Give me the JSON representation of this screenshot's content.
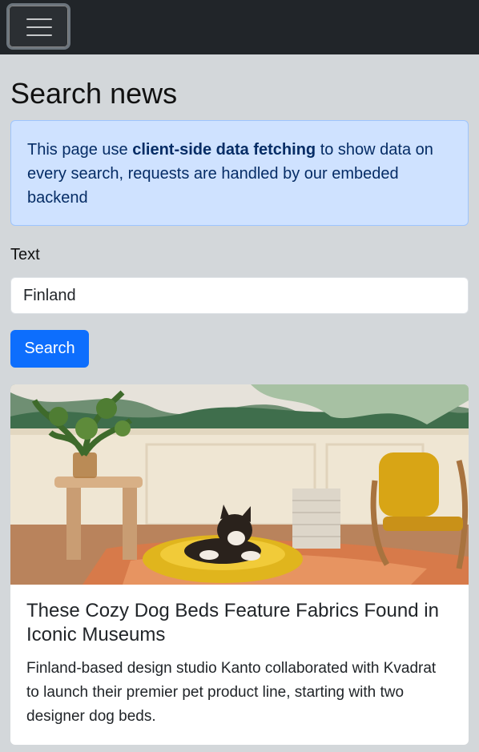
{
  "nav": {
    "menu_icon": "hamburger-menu-icon"
  },
  "page": {
    "title": "Search news",
    "alert": {
      "prefix": "This page use ",
      "bold": "client-side data fetching",
      "suffix": " to show data on every search, requests are handled by our embeded backend"
    },
    "field_label": "Text",
    "field_value": "Finland",
    "search_button": "Search"
  },
  "results": [
    {
      "image_icon": "dog-bed-photo",
      "title": "These Cozy Dog Beds Feature Fabrics Found in Iconic Museums",
      "text": "Finland-based design studio Kanto collaborated with Kvadrat to launch their premier pet product line, starting with two designer dog beds."
    }
  ],
  "colors": {
    "navbar": "#212529",
    "background": "#d3d7da",
    "alert_bg": "#cfe2ff",
    "primary": "#0d6efd"
  }
}
